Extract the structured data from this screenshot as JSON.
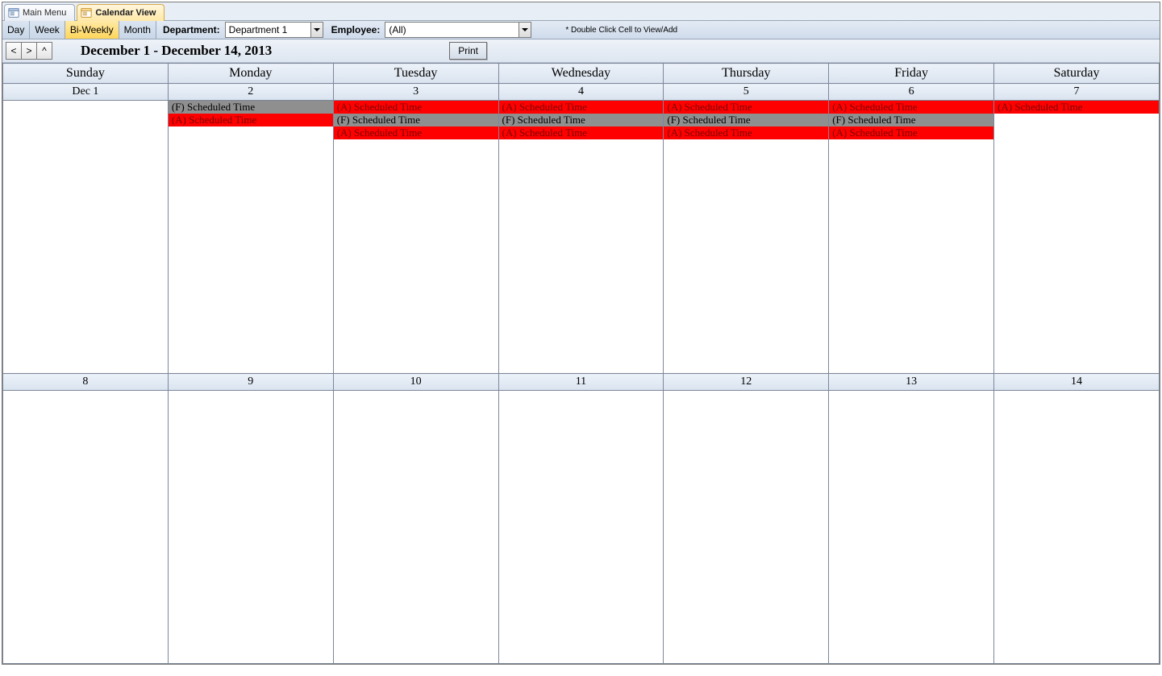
{
  "tabs": [
    {
      "label": "Main Menu",
      "active": false
    },
    {
      "label": "Calendar View",
      "active": true
    }
  ],
  "views": {
    "day": "Day",
    "week": "Week",
    "biweekly": "Bi-Weekly",
    "month": "Month",
    "active": "biweekly"
  },
  "filters": {
    "department_label": "Department:",
    "department_value": "Department 1",
    "employee_label": "Employee:",
    "employee_value": "(All)"
  },
  "hint": "* Double Click Cell to View/Add",
  "nav": {
    "prev": "<",
    "next": ">",
    "up": "^",
    "date_range": "December 1 - December 14, 2013",
    "print": "Print"
  },
  "day_headers": [
    "Sunday",
    "Monday",
    "Tuesday",
    "Wednesday",
    "Thursday",
    "Friday",
    "Saturday"
  ],
  "week1_dates": [
    "Dec 1",
    "2",
    "3",
    "4",
    "5",
    "6",
    "7"
  ],
  "week2_dates": [
    "8",
    "9",
    "10",
    "11",
    "12",
    "13",
    "14"
  ],
  "week1_events": [
    [],
    [
      {
        "text": "(F) Scheduled Time",
        "style": "gray"
      },
      {
        "text": "(A) Scheduled Time",
        "style": "red"
      }
    ],
    [
      {
        "text": "(A) Scheduled Time",
        "style": "red"
      },
      {
        "text": "(F) Scheduled Time",
        "style": "gray"
      },
      {
        "text": "(A) Scheduled Time",
        "style": "red"
      }
    ],
    [
      {
        "text": "(A) Scheduled Time",
        "style": "red"
      },
      {
        "text": "(F) Scheduled Time",
        "style": "gray"
      },
      {
        "text": "(A) Scheduled Time",
        "style": "red"
      }
    ],
    [
      {
        "text": "(A) Scheduled Time",
        "style": "red"
      },
      {
        "text": "(F) Scheduled Time",
        "style": "gray"
      },
      {
        "text": "(A) Scheduled Time",
        "style": "red"
      }
    ],
    [
      {
        "text": "(A) Scheduled Time",
        "style": "red"
      },
      {
        "text": "(F) Scheduled Time",
        "style": "gray"
      },
      {
        "text": "(A) Scheduled Time",
        "style": "red"
      }
    ],
    [
      {
        "text": "(A) Scheduled Time",
        "style": "red"
      }
    ]
  ],
  "week2_events": [
    [],
    [],
    [],
    [],
    [],
    [],
    []
  ]
}
